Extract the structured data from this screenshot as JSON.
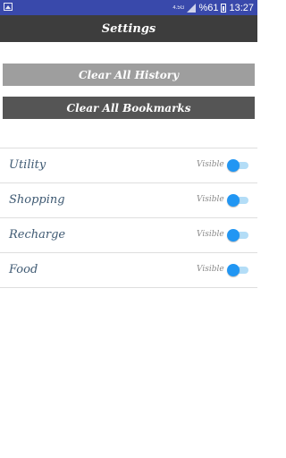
{
  "status_bar": {
    "network_label": "4.5G",
    "battery": "%61",
    "time": "13:27"
  },
  "app_bar": {
    "title": "Settings"
  },
  "actions": {
    "clear_history": "Clear All History",
    "clear_bookmarks": "Clear All Bookmarks"
  },
  "categories": [
    {
      "name": "Utility",
      "status": "Visible",
      "enabled": true
    },
    {
      "name": "Shopping",
      "status": "Visible",
      "enabled": true
    },
    {
      "name": "Recharge",
      "status": "Visible",
      "enabled": true
    },
    {
      "name": "Food",
      "status": "Visible",
      "enabled": true
    }
  ],
  "colors": {
    "status_bar": "#3949ab",
    "app_bar": "#3d3d3d",
    "history_button": "#9e9e9e",
    "bookmarks_button": "#555555",
    "toggle_accent": "#2196f3",
    "category_text": "#3f5a73"
  }
}
